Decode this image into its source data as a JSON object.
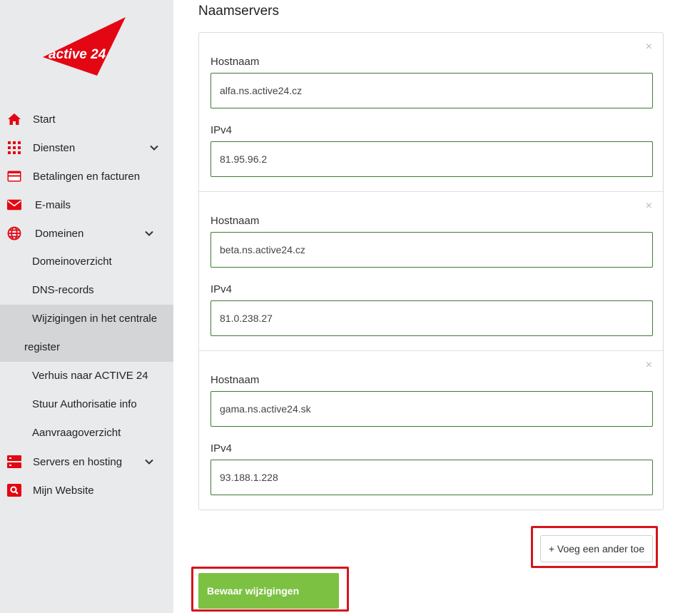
{
  "brand": {
    "logo_text": "active 24",
    "accent": "#e30613"
  },
  "sidebar": {
    "items": [
      {
        "label": "Start",
        "icon": "home-icon"
      },
      {
        "label": "Diensten",
        "icon": "grid-icon"
      },
      {
        "label": "Betalingen en facturen",
        "icon": "credit-card-icon"
      },
      {
        "label": "E-mails",
        "icon": "envelope-icon"
      },
      {
        "label": "Domeinen",
        "icon": "globe-icon"
      }
    ],
    "domain_sub": [
      {
        "label": "Domeinoverzicht"
      },
      {
        "label": "DNS-records"
      },
      {
        "label_line1": "Wijzigingen in het centrale",
        "label_line2": "register"
      },
      {
        "label": "Verhuis naar ACTIVE 24"
      },
      {
        "label": "Stuur Authorisatie info"
      },
      {
        "label": "Aanvraagoverzicht"
      }
    ],
    "bottom_items": [
      {
        "label": "Servers en hosting",
        "icon": "server-icon"
      },
      {
        "label": "Mijn Website",
        "icon": "search-icon"
      }
    ]
  },
  "main": {
    "title": "Naamservers",
    "nameservers": [
      {
        "hostname_label": "Hostnaam",
        "hostname": "alfa.ns.active24.cz",
        "ipv4_label": "IPv4",
        "ipv4": "81.95.96.2"
      },
      {
        "hostname_label": "Hostnaam",
        "hostname": "beta.ns.active24.cz",
        "ipv4_label": "IPv4",
        "ipv4": "81.0.238.27"
      },
      {
        "hostname_label": "Hostnaam",
        "hostname": "gama.ns.active24.sk",
        "ipv4_label": "IPv4",
        "ipv4": "93.188.1.228"
      }
    ],
    "close_symbol": "×",
    "add_button": "+ Voeg een ander toe",
    "save_button": "Bewaar wijzigingen"
  },
  "colors": {
    "save_green": "#7dc143",
    "input_border": "#3f7a35",
    "highlight_red": "#d6141c",
    "sidebar_bg": "#e9eaeb"
  }
}
